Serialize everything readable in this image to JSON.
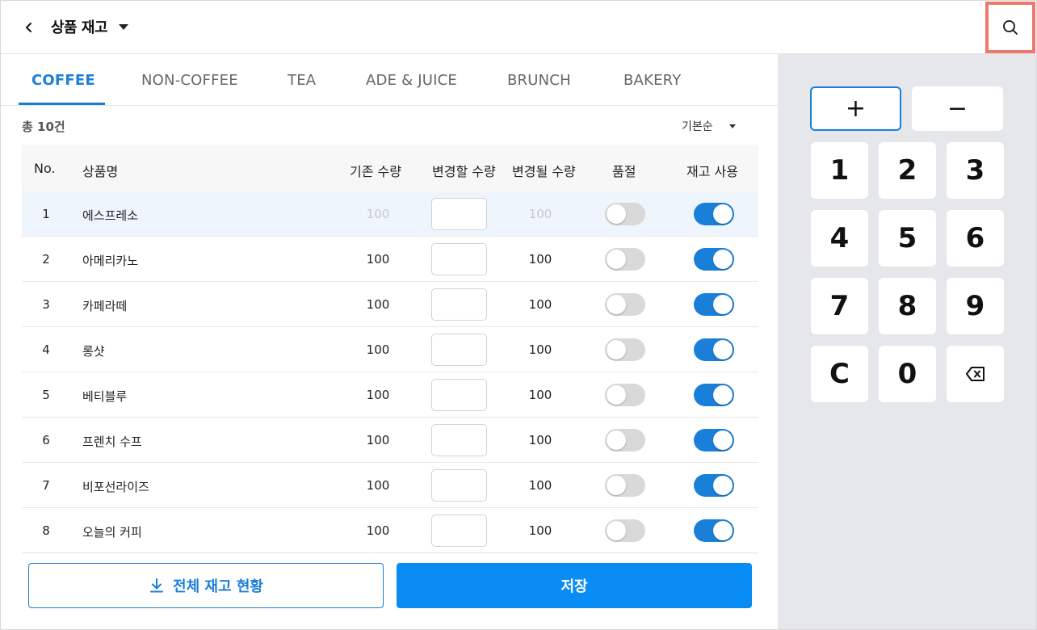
{
  "header": {
    "title": "상품 재고",
    "back_icon": "chevron-left-icon",
    "search_icon": "search-icon"
  },
  "tabs": [
    {
      "label": "COFFEE",
      "active": true
    },
    {
      "label": "NON-COFFEE",
      "active": false
    },
    {
      "label": "TEA",
      "active": false
    },
    {
      "label": "ADE & JUICE",
      "active": false
    },
    {
      "label": "BRUNCH",
      "active": false
    },
    {
      "label": "BAKERY",
      "active": false
    }
  ],
  "list": {
    "total_label": "총 10건",
    "sort_label": "기본순"
  },
  "table": {
    "columns": [
      "No.",
      "상품명",
      "기존 수량",
      "변경할 수량",
      "변경될 수량",
      "품절",
      "재고 사용"
    ],
    "rows": [
      {
        "no": "1",
        "name": "에스프레소",
        "current": "100",
        "change": "",
        "result": "100",
        "soldout": false,
        "use_stock": true
      },
      {
        "no": "2",
        "name": "아메리카노",
        "current": "100",
        "change": "",
        "result": "100",
        "soldout": false,
        "use_stock": true
      },
      {
        "no": "3",
        "name": "카페라떼",
        "current": "100",
        "change": "",
        "result": "100",
        "soldout": false,
        "use_stock": true
      },
      {
        "no": "4",
        "name": "롱샷",
        "current": "100",
        "change": "",
        "result": "100",
        "soldout": false,
        "use_stock": true
      },
      {
        "no": "5",
        "name": "베티블루",
        "current": "100",
        "change": "",
        "result": "100",
        "soldout": false,
        "use_stock": true
      },
      {
        "no": "6",
        "name": "프렌치 수프",
        "current": "100",
        "change": "",
        "result": "100",
        "soldout": false,
        "use_stock": true
      },
      {
        "no": "7",
        "name": "비포선라이즈",
        "current": "100",
        "change": "",
        "result": "100",
        "soldout": false,
        "use_stock": true
      },
      {
        "no": "8",
        "name": "오늘의 커피",
        "current": "100",
        "change": "",
        "result": "100",
        "soldout": false,
        "use_stock": true
      }
    ]
  },
  "buttons": {
    "export_label": "전체 재고 현황",
    "save_label": "저장"
  },
  "keypad": {
    "ops": [
      "+",
      "−"
    ],
    "keys": [
      "1",
      "2",
      "3",
      "4",
      "5",
      "6",
      "7",
      "8",
      "9",
      "C",
      "0"
    ],
    "backspace_icon": "backspace-icon"
  },
  "colors": {
    "accent": "#1a7fd9",
    "save": "#0a8cf5",
    "highlight_border": "#f0776b",
    "panel_bg": "#e6e7ea"
  }
}
